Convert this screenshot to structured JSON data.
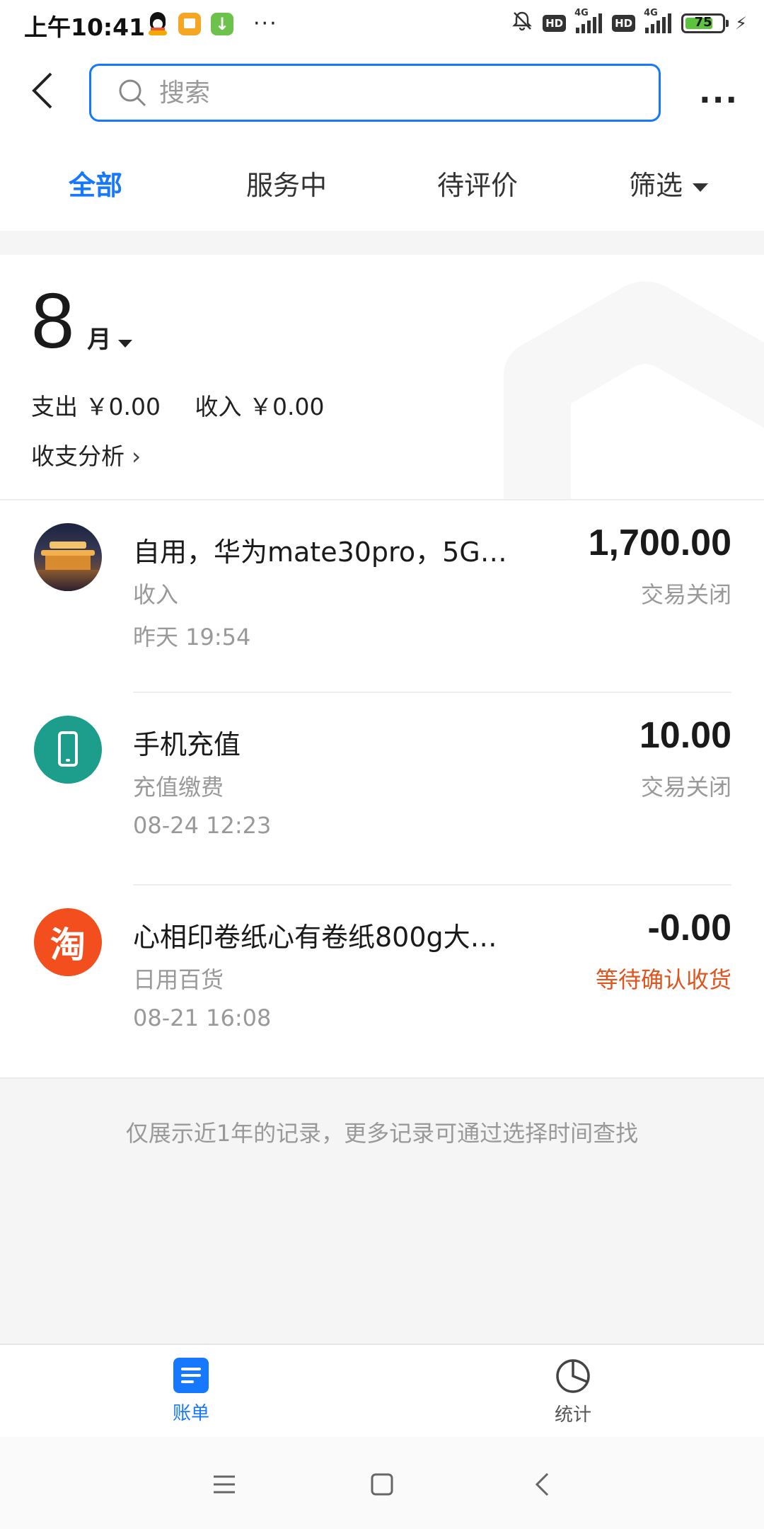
{
  "status_bar": {
    "time": "上午10:41",
    "dots": "···",
    "network_label": "4G",
    "hd_label": "HD",
    "battery_level": "75"
  },
  "header": {
    "search_placeholder": "搜索",
    "more_label": "···"
  },
  "tabs": [
    {
      "label": "全部",
      "active": true
    },
    {
      "label": "服务中",
      "active": false
    },
    {
      "label": "待评价",
      "active": false
    },
    {
      "label": "筛选",
      "active": false
    }
  ],
  "summary": {
    "month": "8",
    "month_unit": "月",
    "expense": "支出 ￥0.00",
    "income": "收入 ￥0.00",
    "analysis_label": "收支分析",
    "analysis_chevron": "›"
  },
  "transactions": [
    {
      "title": "自用，华为mate30pro，5G…",
      "category": "收入",
      "time": "昨天  19:54",
      "amount": "1,700.00",
      "status": "交易关闭",
      "icon": "pagoda-photo-icon"
    },
    {
      "title": "手机充值",
      "category": "充值缴费",
      "time": "08-24  12:23",
      "amount": "10.00",
      "status": "交易关闭",
      "icon": "mobile-phone-icon"
    },
    {
      "title": "心相印卷纸心有卷纸800g大…",
      "category": "日用百货",
      "time": "08-21  16:08",
      "amount": "-0.00",
      "status": "等待确认收货",
      "icon": "taobao-icon",
      "icon_text": "淘"
    }
  ],
  "footer_note": "仅展示近1年的记录，更多记录可通过选择时间查找",
  "bottom_nav": {
    "bill_label": "账单",
    "stats_label": "统计"
  },
  "colors": {
    "accent": "#1677ff",
    "warning": "#e0541e",
    "taobao": "#f24e1e",
    "phone_icon": "#1d9e8c"
  }
}
